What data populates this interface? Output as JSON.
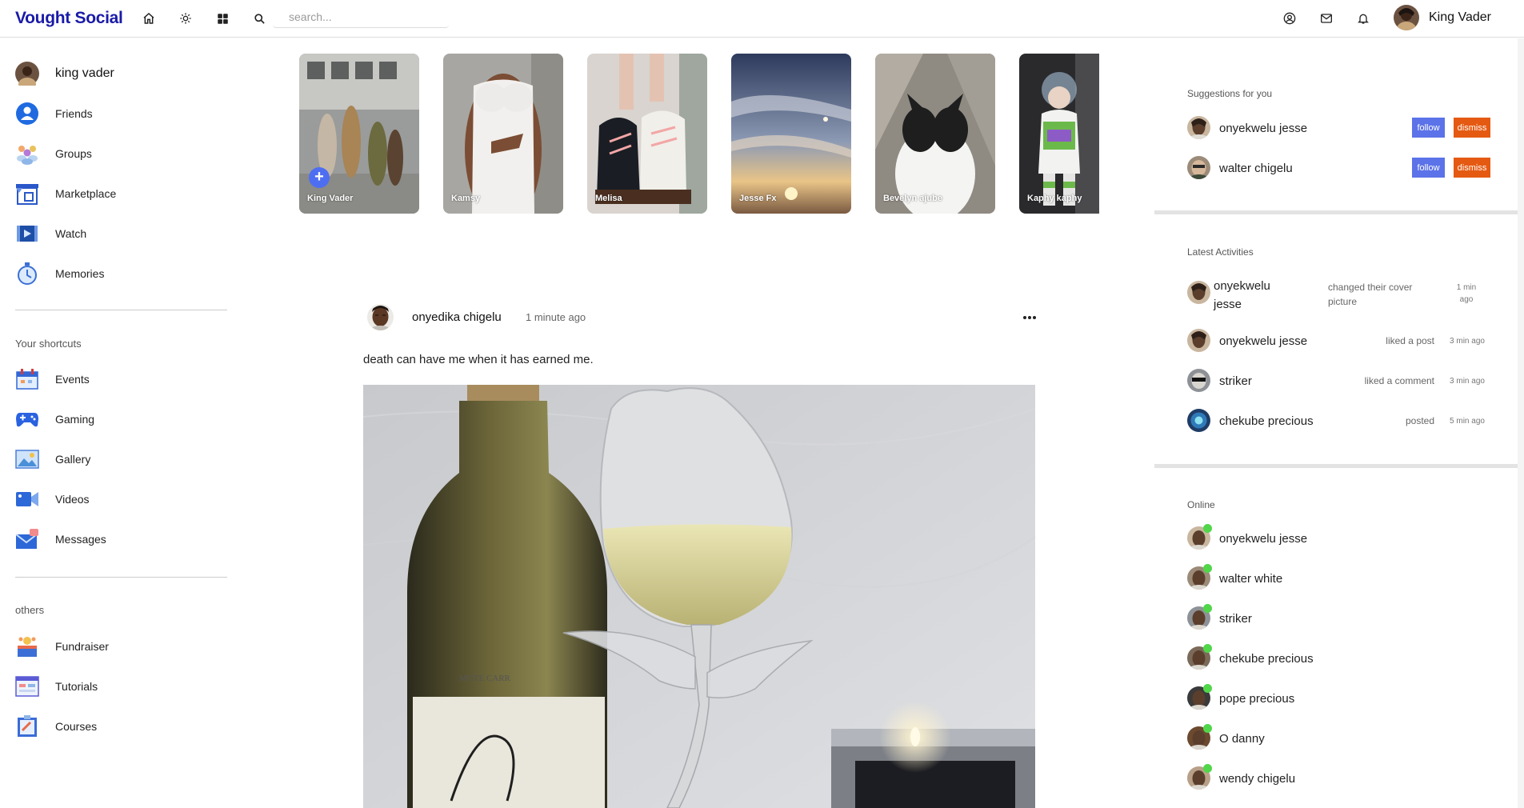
{
  "navbar": {
    "logo": "Vought Social",
    "search_placeholder": "search...",
    "username": "King Vader",
    "icons": [
      "home-icon",
      "brightness-icon",
      "grid-icon",
      "search-icon",
      "user-icon",
      "mail-icon",
      "bell-icon"
    ]
  },
  "sidebar": {
    "user": "king vader",
    "main_items": [
      {
        "label": "Friends",
        "icon": "friends-icon"
      },
      {
        "label": "Groups",
        "icon": "groups-icon"
      },
      {
        "label": "Marketplace",
        "icon": "marketplace-icon"
      },
      {
        "label": "Watch",
        "icon": "watch-icon"
      },
      {
        "label": "Memories",
        "icon": "memories-icon"
      }
    ],
    "shortcuts_title": "Your shortcuts",
    "shortcuts": [
      {
        "label": "Events",
        "icon": "events-icon"
      },
      {
        "label": "Gaming",
        "icon": "gaming-icon"
      },
      {
        "label": "Gallery",
        "icon": "gallery-icon"
      },
      {
        "label": "Videos",
        "icon": "videos-icon"
      },
      {
        "label": "Messages",
        "icon": "messages-icon"
      }
    ],
    "others_title": "others",
    "others": [
      {
        "label": "Fundraiser",
        "icon": "fundraiser-icon"
      },
      {
        "label": "Tutorials",
        "icon": "tutorials-icon"
      },
      {
        "label": "Courses",
        "icon": "courses-icon"
      }
    ]
  },
  "stories": [
    {
      "name": "King Vader"
    },
    {
      "name": "Kamsy"
    },
    {
      "name": "Melisa"
    },
    {
      "name": "Jesse Fx"
    },
    {
      "name": "Bevelyn ajube"
    },
    {
      "name": "Kaphy kaphy"
    }
  ],
  "post": {
    "author": "onyedika chigelu",
    "time": "1 minute ago",
    "text": "death can have me when it has earned me."
  },
  "suggestions": {
    "title": "Suggestions for you",
    "follow_label": "follow",
    "dismiss_label": "dismiss",
    "users": [
      {
        "name": "onyekwelu jesse"
      },
      {
        "name": "walter chigelu"
      }
    ]
  },
  "activities": {
    "title": "Latest Activities",
    "items": [
      {
        "name": "onyekwelu jesse",
        "action": "changed their cover picture",
        "time": "1 min ago"
      },
      {
        "name": "onyekwelu jesse",
        "action": "liked a post",
        "time": "3 min ago"
      },
      {
        "name": "striker",
        "action": "liked a comment",
        "time": "3 min ago"
      },
      {
        "name": "chekube precious",
        "action": "posted",
        "time": "5 min ago"
      }
    ]
  },
  "online": {
    "title": "Online",
    "users": [
      {
        "name": "onyekwelu jesse"
      },
      {
        "name": "walter white"
      },
      {
        "name": "striker"
      },
      {
        "name": "chekube precious"
      },
      {
        "name": "pope precious"
      },
      {
        "name": "O danny"
      },
      {
        "name": "wendy chigelu"
      }
    ]
  },
  "colors": {
    "brand": "#1a1aa8",
    "follow": "#5b72e8",
    "dismiss": "#e55a12",
    "online": "#51d64a"
  }
}
